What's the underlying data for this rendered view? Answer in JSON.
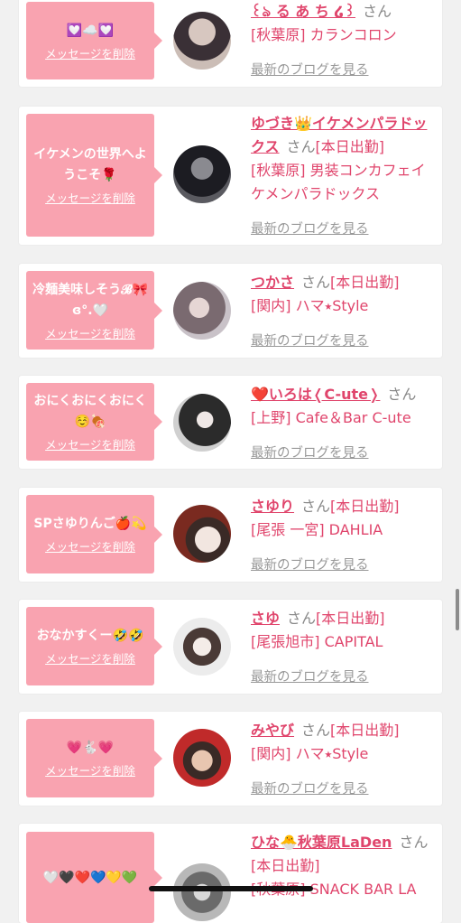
{
  "cards": [
    {
      "message": "💟☁️💟",
      "delete_label": "メッセージを削除",
      "name": "꒰ঌ る あ ち ໒꒱",
      "san": "さん",
      "shift": "",
      "shop": "[秋葉原] カランコロン",
      "blog_label": "最新のブログを見る",
      "avatar_colors": [
        "#3a3036",
        "#d7c7c0"
      ]
    },
    {
      "message": "イケメンの世界へようこそ🌹",
      "delete_label": "メッセージを削除",
      "name": "ゆづき👑イケメンパラドックス",
      "san": "さん",
      "shift": "[本日出勤]",
      "shop": "[秋葉原] 男装コンカフェイケメンパラドックス",
      "blog_label": "最新のブログを見る",
      "avatar_colors": [
        "#1c1c22",
        "#8a8a90"
      ]
    },
    {
      "message": "冷麺美味しそう𝓑🎀ɞ°.🤍",
      "delete_label": "メッセージを削除",
      "name": "つかさ",
      "san": "さん",
      "shift": "[本日出勤]",
      "shop": "[関内] ハマ⭑Style",
      "blog_label": "最新のブログを見る",
      "avatar_colors": [
        "#c9c2c8",
        "#7a6a70"
      ]
    },
    {
      "message": "おにくおにくおにく☺️🍖",
      "delete_label": "メッセージを削除",
      "name": "❤️いろは❬C-ute❭",
      "san": "さん",
      "shift": "",
      "shop": "[上野] Cafe＆Bar C-ute",
      "blog_label": "最新のブログを見る",
      "avatar_colors": [
        "#2b2b2b",
        "#d0d0d0"
      ]
    },
    {
      "message": "SPさゆりんご🍎💫",
      "delete_label": "メッセージを削除",
      "name": "さゆり",
      "san": "さん",
      "shift": "[本日出勤]",
      "shop": "[尾張 一宮] DAHLIA",
      "blog_label": "最新のブログを見る",
      "avatar_colors": [
        "#7a2a20",
        "#f2e6e0"
      ]
    },
    {
      "message": "おなかすくー🤣🤣",
      "delete_label": "メッセージを削除",
      "name": "さゆ",
      "san": "さん",
      "shift": "[本日出勤]",
      "shop": "[尾張旭市] CAPITAL",
      "blog_label": "最新のブログを見る",
      "avatar_colors": [
        "#ececec",
        "#4a3a36"
      ]
    },
    {
      "message": "💗🐇💗",
      "delete_label": "メッセージを削除",
      "name": "みやび",
      "san": "さん",
      "shift": "[本日出勤]",
      "shop": "[関内] ハマ⭑Style",
      "blog_label": "最新のブログを見る",
      "avatar_colors": [
        "#c02a2a",
        "#e8c6b0"
      ]
    },
    {
      "message": "🤍🖤❤️💙💛💚",
      "delete_label": "",
      "name": "ひな🐣秋葉原LaDen",
      "san": "さん",
      "shift": "[本日出勤]",
      "shop": "[秋葉原] SNACK BAR LA",
      "blog_label": "",
      "avatar_colors": [
        "#b8b8b8",
        "#6a6a6a"
      ]
    }
  ],
  "colors": {
    "accent": "#e0456c",
    "bubble": "#f9a3b0",
    "background": "#f1f1f1"
  }
}
